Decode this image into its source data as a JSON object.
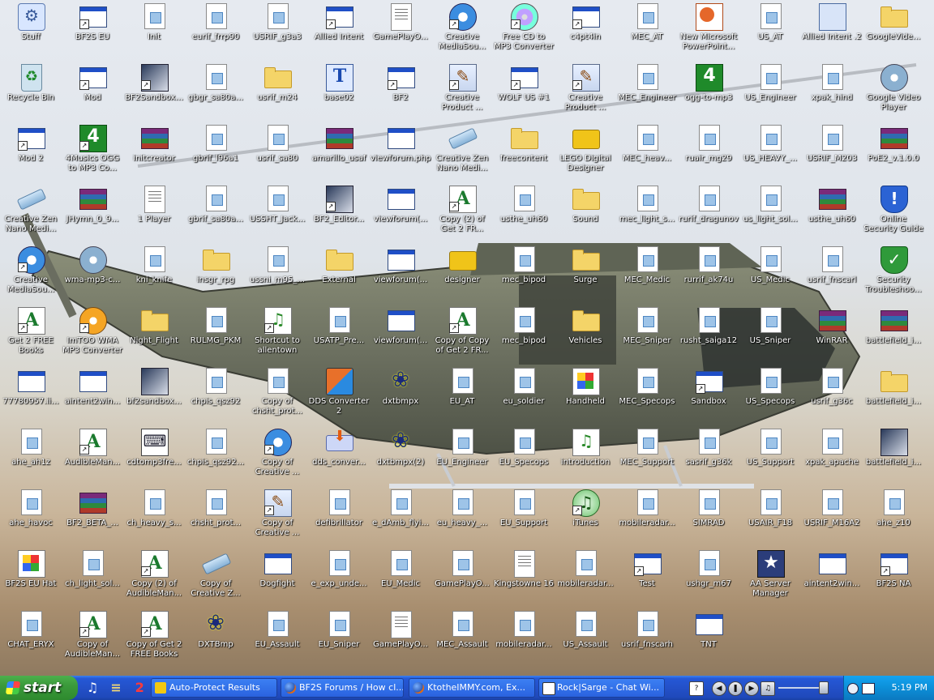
{
  "desktop": {
    "icons": [
      {
        "label": "Stuff",
        "type": "stuff",
        "shortcut": false
      },
      {
        "label": "BF2S EU",
        "type": "app",
        "shortcut": true
      },
      {
        "label": "Init",
        "type": "doc",
        "shortcut": false
      },
      {
        "label": "eurif_frrp90",
        "type": "doc",
        "shortcut": false
      },
      {
        "label": "USRIF_g3a3",
        "type": "doc",
        "shortcut": false
      },
      {
        "label": "Allied Intent",
        "type": "app",
        "shortcut": true
      },
      {
        "label": "GamePlayO...",
        "type": "text",
        "shortcut": false
      },
      {
        "label": "Creative MediaSou...",
        "type": "media",
        "shortcut": true
      },
      {
        "label": "Free CD to MP3 Converter",
        "type": "cd",
        "shortcut": true
      },
      {
        "label": "c4pt4in",
        "type": "app",
        "shortcut": true
      },
      {
        "label": "MEC_AT",
        "type": "doc",
        "shortcut": false
      },
      {
        "label": "New Microsoft PowerPoint...",
        "type": "ppt",
        "shortcut": false
      },
      {
        "label": "US_AT",
        "type": "doc",
        "shortcut": false
      },
      {
        "label": "Allied Intent .2",
        "type": "misc",
        "shortcut": false
      },
      {
        "label": "GoogleVide...",
        "type": "folder",
        "shortcut": false
      },
      {
        "label": "Recycle Bin",
        "type": "recycle",
        "shortcut": false
      },
      {
        "label": "Mod",
        "type": "app",
        "shortcut": true
      },
      {
        "label": "BF2Sandbox...",
        "type": "bf2",
        "shortcut": true
      },
      {
        "label": "gbgr_sa80a...",
        "type": "doc",
        "shortcut": false
      },
      {
        "label": "usrif_m24",
        "type": "folder",
        "shortcut": false
      },
      {
        "label": "base02",
        "type": "tf",
        "shortcut": false
      },
      {
        "label": "BF2",
        "type": "app",
        "shortcut": true
      },
      {
        "label": "Creative Product ...",
        "type": "creator",
        "shortcut": true
      },
      {
        "label": "WOLF US #1",
        "type": "app",
        "shortcut": true
      },
      {
        "label": "Creative Product ...",
        "type": "creator",
        "shortcut": true
      },
      {
        "label": "MEC_Engineer",
        "type": "doc",
        "shortcut": false
      },
      {
        "label": "ogg-to-mp3",
        "type": "green4",
        "shortcut": false
      },
      {
        "label": "US_Engineer",
        "type": "doc",
        "shortcut": false
      },
      {
        "label": "xpak_hind",
        "type": "doc",
        "shortcut": false
      },
      {
        "label": "Google Video Player",
        "type": "sonic",
        "shortcut": false
      },
      {
        "label": "Mod 2",
        "type": "app",
        "shortcut": true
      },
      {
        "label": "4Musics OGG to MP3 Co...",
        "type": "green4",
        "shortcut": true
      },
      {
        "label": "initcreator",
        "type": "rar",
        "shortcut": false
      },
      {
        "label": "gbrif_l96a1",
        "type": "doc",
        "shortcut": false
      },
      {
        "label": "usrif_sa80",
        "type": "doc",
        "shortcut": false
      },
      {
        "label": "amarillo_usaf",
        "type": "rar",
        "shortcut": false
      },
      {
        "label": "viewforum.php",
        "type": "app",
        "shortcut": false
      },
      {
        "label": "Creative Zen Nano Medi...",
        "type": "zen",
        "shortcut": false
      },
      {
        "label": "freecontent",
        "type": "folder",
        "shortcut": false
      },
      {
        "label": "LEGO Digital Designer",
        "type": "lego",
        "shortcut": false
      },
      {
        "label": "MEC_heav...",
        "type": "doc",
        "shortcut": false
      },
      {
        "label": "ruair_mg29",
        "type": "doc",
        "shortcut": false
      },
      {
        "label": "US_HEAVY_...",
        "type": "doc",
        "shortcut": false
      },
      {
        "label": "USRIF_M203",
        "type": "doc",
        "shortcut": false
      },
      {
        "label": "PoE2_v.1.0.0",
        "type": "rar",
        "shortcut": false
      },
      {
        "label": "Creative Zen Nano Medi...",
        "type": "zen",
        "shortcut": false
      },
      {
        "label": "JHymn_0_9...",
        "type": "rar",
        "shortcut": false
      },
      {
        "label": "1 Player",
        "type": "text",
        "shortcut": false
      },
      {
        "label": "gbrif_sa80a...",
        "type": "doc",
        "shortcut": false
      },
      {
        "label": "USSHT_Jack...",
        "type": "doc",
        "shortcut": false
      },
      {
        "label": "BF2_Editor...",
        "type": "bf2",
        "shortcut": true
      },
      {
        "label": "viewforum(...",
        "type": "app",
        "shortcut": false
      },
      {
        "label": "Copy (2) of Get 2 FR...",
        "type": "a",
        "shortcut": true
      },
      {
        "label": "usthe_uh60",
        "type": "doc",
        "shortcut": false
      },
      {
        "label": "Sound",
        "type": "folder",
        "shortcut": false
      },
      {
        "label": "mec_light_s...",
        "type": "doc",
        "shortcut": false
      },
      {
        "label": "rurif_dragunov",
        "type": "doc",
        "shortcut": false
      },
      {
        "label": "us_light_sol...",
        "type": "doc",
        "shortcut": false
      },
      {
        "label": "usthe_uh60",
        "type": "rar",
        "shortcut": false
      },
      {
        "label": "Online Security Guide",
        "type": "shield-blue",
        "shortcut": false
      },
      {
        "label": "Creative MediaSou...",
        "type": "media",
        "shortcut": true
      },
      {
        "label": "wma-mp3-c...",
        "type": "sonic",
        "shortcut": false
      },
      {
        "label": "kni_knife",
        "type": "doc",
        "shortcut": false
      },
      {
        "label": "insgr_rpg",
        "type": "folder",
        "shortcut": false
      },
      {
        "label": "ussni_m95_...",
        "type": "doc",
        "shortcut": false
      },
      {
        "label": "External",
        "type": "folder",
        "shortcut": false
      },
      {
        "label": "viewforum(...",
        "type": "app",
        "shortcut": false
      },
      {
        "label": "designer",
        "type": "lego",
        "shortcut": false
      },
      {
        "label": "mec_bipod",
        "type": "doc",
        "shortcut": false
      },
      {
        "label": "Surge",
        "type": "folder",
        "shortcut": false
      },
      {
        "label": "MEC_Medic",
        "type": "doc",
        "shortcut": false
      },
      {
        "label": "rurrif_ak74u",
        "type": "doc",
        "shortcut": false
      },
      {
        "label": "US_Medic",
        "type": "doc",
        "shortcut": false
      },
      {
        "label": "usrif_fnscarl",
        "type": "doc",
        "shortcut": false
      },
      {
        "label": "Security Troubleshoo...",
        "type": "shield-green",
        "shortcut": false
      },
      {
        "label": "Get 2 FREE Books",
        "type": "a",
        "shortcut": true
      },
      {
        "label": "ImTOO WMA MP3 Converter",
        "type": "wma",
        "shortcut": true
      },
      {
        "label": "Night_Flight",
        "type": "folder",
        "shortcut": false
      },
      {
        "label": "RULMG_PKM",
        "type": "doc",
        "shortcut": false
      },
      {
        "label": "Shortcut to allentown",
        "type": "mp3",
        "shortcut": true
      },
      {
        "label": "USATP_Pre...",
        "type": "doc",
        "shortcut": false
      },
      {
        "label": "viewforum(...",
        "type": "app",
        "shortcut": false
      },
      {
        "label": "Copy of Copy of Get 2 FR...",
        "type": "a",
        "shortcut": true
      },
      {
        "label": "mec_bipod",
        "type": "doc",
        "shortcut": false
      },
      {
        "label": "Vehicles",
        "type": "folder",
        "shortcut": false
      },
      {
        "label": "MEC_Sniper",
        "type": "doc",
        "shortcut": false
      },
      {
        "label": "rusht_saiga12",
        "type": "doc",
        "shortcut": false
      },
      {
        "label": "US_Sniper",
        "type": "doc",
        "shortcut": false
      },
      {
        "label": "WinRAR",
        "type": "rar",
        "shortcut": false
      },
      {
        "label": "battlefield_i...",
        "type": "rar",
        "shortcut": false
      },
      {
        "label": "77780957.ii...",
        "type": "app",
        "shortcut": false
      },
      {
        "label": "aintent2win...",
        "type": "app",
        "shortcut": false
      },
      {
        "label": "bf2sandbox...",
        "type": "bf2",
        "shortcut": false
      },
      {
        "label": "chpis_qsz92",
        "type": "doc",
        "shortcut": false
      },
      {
        "label": "Copy of chsht_prot...",
        "type": "doc",
        "shortcut": false
      },
      {
        "label": "DDS Converter 2",
        "type": "dds",
        "shortcut": false
      },
      {
        "label": "dxtbmpx",
        "type": "butterfly",
        "shortcut": false
      },
      {
        "label": "EU_AT",
        "type": "doc",
        "shortcut": false
      },
      {
        "label": "eu_soldier",
        "type": "doc",
        "shortcut": false
      },
      {
        "label": "Handheld",
        "type": "handheld",
        "shortcut": false
      },
      {
        "label": "MEC_Specops",
        "type": "doc",
        "shortcut": false
      },
      {
        "label": "Sandbox",
        "type": "app",
        "shortcut": true
      },
      {
        "label": "US_Specops",
        "type": "doc",
        "shortcut": false
      },
      {
        "label": "usrif_g36c",
        "type": "doc",
        "shortcut": false
      },
      {
        "label": "battlefield_i...",
        "type": "folder",
        "shortcut": false
      },
      {
        "label": "ahe_ah1z",
        "type": "doc",
        "shortcut": false
      },
      {
        "label": "AudibleMan...",
        "type": "a",
        "shortcut": true
      },
      {
        "label": "cdtomp3fre...",
        "type": "cdtomp3",
        "shortcut": false
      },
      {
        "label": "chpis_qsz92...",
        "type": "doc",
        "shortcut": false
      },
      {
        "label": "Copy of Creative ...",
        "type": "media",
        "shortcut": true
      },
      {
        "label": "dds_conver...",
        "type": "install",
        "shortcut": false
      },
      {
        "label": "dxtbmpx(2)",
        "type": "butterfly",
        "shortcut": false
      },
      {
        "label": "EU_Engineer",
        "type": "doc",
        "shortcut": false
      },
      {
        "label": "EU_Specops",
        "type": "doc",
        "shortcut": false
      },
      {
        "label": "introduction",
        "type": "mp3",
        "shortcut": false
      },
      {
        "label": "MEC_Support",
        "type": "doc",
        "shortcut": false
      },
      {
        "label": "sasrif_g36k",
        "type": "doc",
        "shortcut": false
      },
      {
        "label": "US_Support",
        "type": "doc",
        "shortcut": false
      },
      {
        "label": "xpak_apache",
        "type": "doc",
        "shortcut": false
      },
      {
        "label": "battlefield_i...",
        "type": "bf2",
        "shortcut": false
      },
      {
        "label": "ahe_havoc",
        "type": "doc",
        "shortcut": false
      },
      {
        "label": "BF2_BETA_...",
        "type": "rar",
        "shortcut": false
      },
      {
        "label": "ch_heavy_s...",
        "type": "doc",
        "shortcut": false
      },
      {
        "label": "chsht_prot...",
        "type": "doc",
        "shortcut": false
      },
      {
        "label": "Copy of Creative ...",
        "type": "creator",
        "shortcut": true
      },
      {
        "label": "defibrillator",
        "type": "doc",
        "shortcut": false
      },
      {
        "label": "e_dAmb_flyi...",
        "type": "doc",
        "shortcut": false
      },
      {
        "label": "eu_heavy_...",
        "type": "doc",
        "shortcut": false
      },
      {
        "label": "EU_Support",
        "type": "doc",
        "shortcut": false
      },
      {
        "label": "iTunes",
        "type": "itunes",
        "shortcut": true
      },
      {
        "label": "mobileradar...",
        "type": "doc",
        "shortcut": false
      },
      {
        "label": "SIMRAD",
        "type": "doc",
        "shortcut": false
      },
      {
        "label": "USAIR_F18",
        "type": "doc",
        "shortcut": false
      },
      {
        "label": "USRIF_M16A2",
        "type": "doc",
        "shortcut": false
      },
      {
        "label": "ahe_z10",
        "type": "doc",
        "shortcut": false
      },
      {
        "label": "BF2S EU Hat",
        "type": "handheld",
        "shortcut": false
      },
      {
        "label": "ch_light_sol...",
        "type": "doc",
        "shortcut": false
      },
      {
        "label": "Copy (2) of AudibleMan...",
        "type": "a",
        "shortcut": true
      },
      {
        "label": "Copy of Creative Z...",
        "type": "zen",
        "shortcut": false
      },
      {
        "label": "Dogfight",
        "type": "app",
        "shortcut": false
      },
      {
        "label": "e_exp_unde...",
        "type": "doc",
        "shortcut": false
      },
      {
        "label": "EU_Medic",
        "type": "doc",
        "shortcut": false
      },
      {
        "label": "GamePlayO...",
        "type": "doc",
        "shortcut": false
      },
      {
        "label": "Kingstowne 16",
        "type": "text",
        "shortcut": false
      },
      {
        "label": "mobileradar...",
        "type": "doc",
        "shortcut": false
      },
      {
        "label": "Test",
        "type": "app",
        "shortcut": true
      },
      {
        "label": "ushgr_m67",
        "type": "doc",
        "shortcut": false
      },
      {
        "label": "AA Server Manager",
        "type": "star",
        "shortcut": false
      },
      {
        "label": "aintent2win...",
        "type": "app",
        "shortcut": false
      },
      {
        "label": "BF2S NA",
        "type": "app",
        "shortcut": true
      },
      {
        "label": "CHAT_ERYX",
        "type": "doc",
        "shortcut": false
      },
      {
        "label": "Copy of AudibleMan...",
        "type": "a",
        "shortcut": true
      },
      {
        "label": "Copy of Get 2 FREE Books",
        "type": "a",
        "shortcut": true
      },
      {
        "label": "DXTBmp",
        "type": "butterfly",
        "shortcut": false
      },
      {
        "label": "EU_Assault",
        "type": "doc",
        "shortcut": false
      },
      {
        "label": "EU_Sniper",
        "type": "doc",
        "shortcut": false
      },
      {
        "label": "GamePlayO...",
        "type": "text",
        "shortcut": false
      },
      {
        "label": "MEC_Assault",
        "type": "doc",
        "shortcut": false
      },
      {
        "label": "mobileradar...",
        "type": "doc",
        "shortcut": false
      },
      {
        "label": "US_Assault",
        "type": "doc",
        "shortcut": false
      },
      {
        "label": "usrif_fnscarh",
        "type": "doc",
        "shortcut": false
      },
      {
        "label": "TNT",
        "type": "app",
        "shortcut": false
      }
    ]
  },
  "taskbar": {
    "start_label": "start",
    "quick_launch": [
      {
        "icon": "music-icon",
        "glyph": "♫"
      },
      {
        "icon": "winrar-icon",
        "glyph": "≡"
      },
      {
        "icon": "two-icon",
        "glyph": "2"
      }
    ],
    "tasks": [
      {
        "label": "Auto-Protect Results",
        "icon": "norton-icon"
      },
      {
        "label": "BF2S Forums / How cl...",
        "icon": "firefox-icon"
      },
      {
        "label": "KtotheIMMY.com, Ex...",
        "icon": "firefox-icon"
      },
      {
        "label": "Rock|Sarge - Chat Wi...",
        "icon": "chat-icon"
      }
    ],
    "clock": "5:19 PM"
  }
}
